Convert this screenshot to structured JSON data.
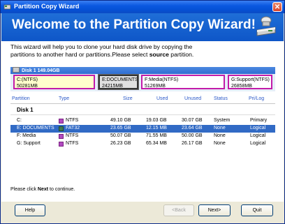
{
  "window": {
    "title": "Partition Copy Wizard",
    "close": "✕"
  },
  "banner": {
    "title": "Welcome to the Partition Copy Wizard!"
  },
  "intro": {
    "line1": "This wizard will help you to clone your hard disk drive by copying the",
    "line2a": "partitions to another hard or partitions.Please select ",
    "line2b": "source",
    "line2c": " partition."
  },
  "disk_bar": {
    "label": "Disk 1   149.04GB"
  },
  "partition_boxes": [
    {
      "name": "C:(NTFS)",
      "size": "50281MB"
    },
    {
      "name": "E:DOCUMENTS(...",
      "size": "24215MB"
    },
    {
      "name": "F:Media(NTFS)",
      "size": "51269MB"
    },
    {
      "name": "G:Support(NTFS)",
      "size": "26858MB"
    }
  ],
  "table": {
    "headers": {
      "partition": "Partition",
      "type": "Type",
      "size": "Size",
      "used": "Used",
      "unused": "Unused",
      "status": "Status",
      "prilog": "Pri/Log"
    },
    "disk_label": "Disk 1",
    "rows": [
      {
        "partition": "C:",
        "type": "NTFS",
        "size": "49.10 GB",
        "used": "19.03 GB",
        "unused": "30.07 GB",
        "status": "System",
        "prilog": "Primary"
      },
      {
        "partition": "E: DOCUMENTS",
        "type": "FAT32",
        "size": "23.65 GB",
        "used": "12.15 MB",
        "unused": "23.64 GB",
        "status": "None",
        "prilog": "Logical"
      },
      {
        "partition": "F: Media",
        "type": "NTFS",
        "size": "50.07 GB",
        "used": "71.55 MB",
        "unused": "50.00 GB",
        "status": "None",
        "prilog": "Logical"
      },
      {
        "partition": "G: Support",
        "type": "NTFS",
        "size": "26.23 GB",
        "used": "65.34 MB",
        "unused": "26.17 GB",
        "status": "None",
        "prilog": "Logical"
      }
    ]
  },
  "footnote": {
    "pre": "Please click ",
    "bold": "Next",
    "post": " to continue."
  },
  "buttons": {
    "help": "Help",
    "back": "<Back",
    "next": "Next>",
    "quit": "Quit"
  },
  "colors": {
    "title_bar": "#0a58e0",
    "banner": "#1f6ed7",
    "partition_border": "#c21ba9",
    "selection": "#316ac5"
  }
}
